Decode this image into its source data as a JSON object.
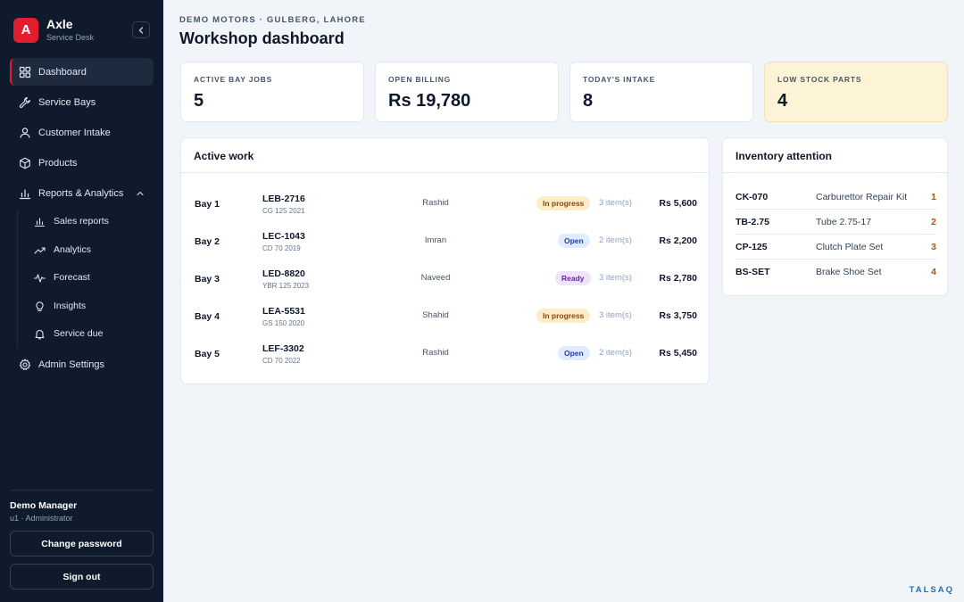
{
  "brand": {
    "logo_letter": "A",
    "name": "Axle",
    "subtitle": "Service Desk"
  },
  "sidebar": {
    "items": [
      {
        "label": "Dashboard",
        "icon": "grid-icon",
        "active": true
      },
      {
        "label": "Service Bays",
        "icon": "wrench-icon"
      },
      {
        "label": "Customer Intake",
        "icon": "user-icon"
      },
      {
        "label": "Products",
        "icon": "box-icon"
      },
      {
        "label": "Reports & Analytics",
        "icon": "bar-chart-icon",
        "expanded": true
      },
      {
        "label": "Admin Settings",
        "icon": "gear-icon"
      }
    ],
    "subitems": [
      {
        "label": "Sales reports",
        "icon": "bar-chart-icon"
      },
      {
        "label": "Analytics",
        "icon": "trending-up-icon"
      },
      {
        "label": "Forecast",
        "icon": "pulse-icon"
      },
      {
        "label": "Insights",
        "icon": "lightbulb-icon"
      },
      {
        "label": "Service due",
        "icon": "bell-icon"
      }
    ],
    "user": {
      "name": "Demo Manager",
      "role": "u1 · Administrator"
    },
    "change_password": "Change password",
    "sign_out": "Sign out"
  },
  "header": {
    "eyebrow": "DEMO MOTORS · GULBERG, LAHORE",
    "title": "Workshop dashboard"
  },
  "stats": [
    {
      "label": "ACTIVE BAY JOBS",
      "value": "5"
    },
    {
      "label": "OPEN BILLING",
      "value": "Rs 19,780"
    },
    {
      "label": "TODAY'S INTAKE",
      "value": "8"
    },
    {
      "label": "LOW STOCK PARTS",
      "value": "4",
      "highlight": "#fdf3d6"
    }
  ],
  "active_work": {
    "title": "Active work",
    "rows": [
      {
        "bay": "Bay 1",
        "plate": "LEB-2716",
        "model": "CG 125 2021",
        "mechanic": "Rashid",
        "status": "In progress",
        "items": "3 item(s)",
        "amount": "Rs 5,600"
      },
      {
        "bay": "Bay 2",
        "plate": "LEC-1043",
        "model": "CD 70 2019",
        "mechanic": "Imran",
        "status": "Open",
        "items": "2 item(s)",
        "amount": "Rs 2,200"
      },
      {
        "bay": "Bay 3",
        "plate": "LED-8820",
        "model": "YBR 125 2023",
        "mechanic": "Naveed",
        "status": "Ready",
        "items": "3 item(s)",
        "amount": "Rs 2,780"
      },
      {
        "bay": "Bay 4",
        "plate": "LEA-5531",
        "model": "GS 150 2020",
        "mechanic": "Shahid",
        "status": "In progress",
        "items": "3 item(s)",
        "amount": "Rs 3,750"
      },
      {
        "bay": "Bay 5",
        "plate": "LEF-3302",
        "model": "CD 70 2022",
        "mechanic": "Rashid",
        "status": "Open",
        "items": "2 item(s)",
        "amount": "Rs 5,450"
      }
    ]
  },
  "inventory": {
    "title": "Inventory attention",
    "rows": [
      {
        "code": "CK-070",
        "name": "Carburettor Repair Kit",
        "qty": "1"
      },
      {
        "code": "TB-2.75",
        "name": "Tube 2.75-17",
        "qty": "2"
      },
      {
        "code": "CP-125",
        "name": "Clutch Plate Set",
        "qty": "3"
      },
      {
        "code": "BS-SET",
        "name": "Brake Shoe Set",
        "qty": "4"
      }
    ]
  },
  "colors": {
    "accent": "#e11d2e",
    "sidebar_bg": "#0f1b2d",
    "page_bg": "#f1f5f9",
    "warning": "#b45309"
  },
  "watermark": "TALSAQ"
}
